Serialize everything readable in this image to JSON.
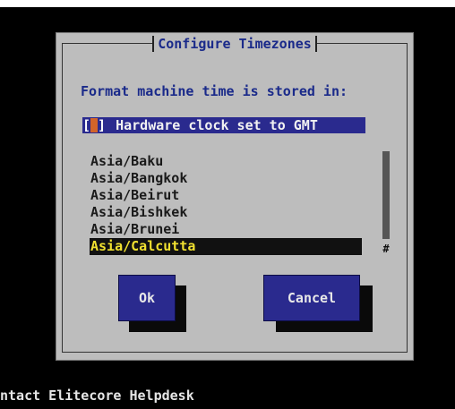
{
  "dialog": {
    "title": "Configure Timezones",
    "prompt": "Format machine time is stored in:",
    "hw_clock": {
      "bracket_open": "[",
      "bracket_close": "]",
      "label": "Hardware clock set to GMT",
      "checked": false
    },
    "timezones": [
      {
        "label": "Asia/Baku",
        "selected": false
      },
      {
        "label": "Asia/Bangkok",
        "selected": false
      },
      {
        "label": "Asia/Beirut",
        "selected": false
      },
      {
        "label": "Asia/Bishkek",
        "selected": false
      },
      {
        "label": "Asia/Brunei",
        "selected": false
      },
      {
        "label": "Asia/Calcutta",
        "selected": true
      }
    ],
    "scroll_marker": "#",
    "buttons": {
      "ok": "Ok",
      "cancel": "Cancel"
    }
  },
  "status_line": "ntact Elitecore Helpdesk"
}
